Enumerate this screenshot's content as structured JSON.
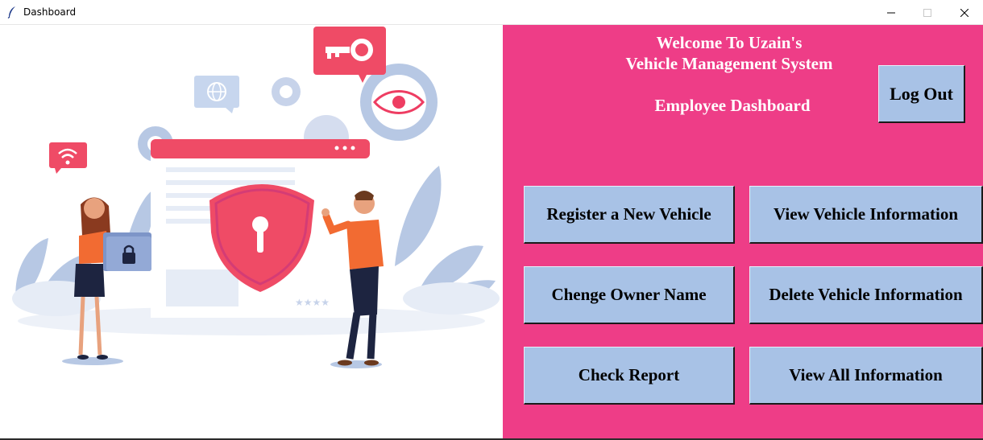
{
  "window": {
    "title": "Dashboard",
    "controls": [
      "minimize",
      "maximize",
      "close"
    ]
  },
  "header": {
    "line1": "Welcome To Uzain's",
    "line2": "Vehicle Management System",
    "subtitle": "Employee Dashboard"
  },
  "actions": {
    "logout": "Log Out",
    "register": "Register a New Vehicle",
    "view_vehicle": "View Vehicle Information",
    "change_owner": "Chenge Owner Name",
    "delete_vehicle": "Delete Vehicle Information",
    "check_report": "Check Report",
    "view_all": "View All Information"
  },
  "colors": {
    "panel_background": "#ee3d87",
    "button_background": "#a8c2e6",
    "header_text": "#ffffff"
  },
  "illustration": {
    "icons": [
      "key-icon",
      "globe-icon",
      "gear-icon",
      "eye-icon",
      "wifi-icon",
      "shield-lock-icon",
      "padlock-folder-icon"
    ]
  }
}
